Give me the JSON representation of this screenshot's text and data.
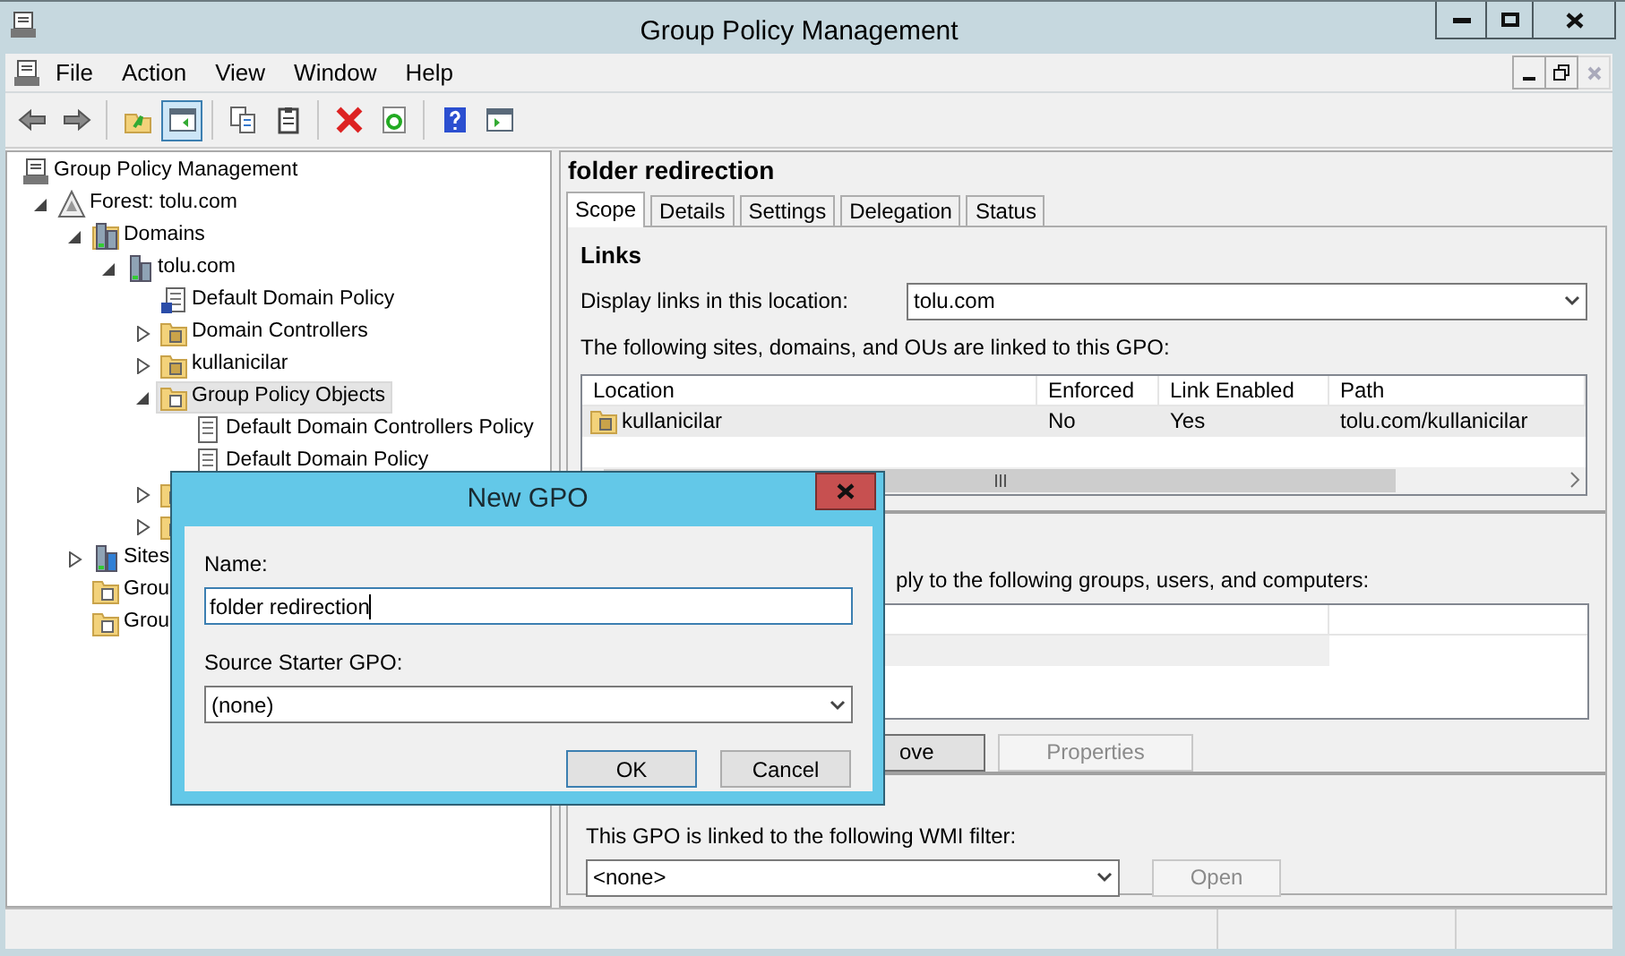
{
  "window": {
    "title": "Group Policy Management"
  },
  "menu": [
    "File",
    "Action",
    "View",
    "Window",
    "Help"
  ],
  "toolbar": [
    [
      {
        "kind": "back",
        "selected": false
      },
      {
        "kind": "forward",
        "selected": false
      }
    ],
    [
      {
        "kind": "up",
        "selected": false
      },
      {
        "kind": "tree",
        "selected": true
      }
    ],
    [
      {
        "kind": "copy",
        "selected": false
      },
      {
        "kind": "paste",
        "selected": false
      }
    ],
    [
      {
        "kind": "delete",
        "selected": false
      },
      {
        "kind": "refresh",
        "selected": false
      }
    ],
    [
      {
        "kind": "help",
        "selected": false
      },
      {
        "kind": "pane",
        "selected": false
      }
    ]
  ],
  "tree": [
    {
      "kind": "console",
      "label": "Group Policy Management",
      "selected": false,
      "children": [
        {
          "kind": "forest",
          "label": "Forest: tolu.com",
          "expanded": true,
          "selected": false,
          "children": [
            {
              "kind": "domains",
              "label": "Domains",
              "expanded": true,
              "selected": false,
              "children": [
                {
                  "kind": "domain",
                  "label": "tolu.com",
                  "expanded": true,
                  "selected": false,
                  "children": [
                    {
                      "kind": "gpo-link",
                      "label": "Default Domain Policy",
                      "selected": false
                    },
                    {
                      "kind": "ou",
                      "label": "Domain Controllers",
                      "expanded": false,
                      "selected": false
                    },
                    {
                      "kind": "ou",
                      "label": "kullanicilar",
                      "expanded": false,
                      "selected": false
                    },
                    {
                      "kind": "gpo-folder",
                      "label": "Group Policy Objects",
                      "expanded": true,
                      "selected": true,
                      "children": [
                        {
                          "kind": "gpo",
                          "label": "Default Domain Controllers Policy",
                          "selected": false
                        },
                        {
                          "kind": "gpo",
                          "label": "Default Domain Policy",
                          "selected": false
                        }
                      ]
                    },
                    {
                      "kind": "gpo-folder",
                      "expanded": false,
                      "selected": false
                    },
                    {
                      "kind": "gpo-folder",
                      "expanded": false,
                      "selected": false
                    }
                  ]
                }
              ]
            },
            {
              "kind": "sites",
              "label": "Sites",
              "expanded": false,
              "selected": false
            },
            {
              "kind": "modeling",
              "label": "Grou",
              "selected": false
            },
            {
              "kind": "results",
              "label": "Grou",
              "selected": false
            }
          ]
        }
      ]
    }
  ],
  "detail": {
    "title": "folder redirection",
    "tabs": [
      {
        "label": "Scope",
        "selected": true
      },
      {
        "label": "Details",
        "selected": false
      },
      {
        "label": "Settings",
        "selected": false
      },
      {
        "label": "Delegation",
        "selected": false
      },
      {
        "label": "Status",
        "selected": false
      }
    ],
    "links": {
      "heading": "Links",
      "location_label": "Display links in this location:",
      "location_value": "tolu.com",
      "caption": "The following sites, domains, and OUs are linked to this GPO:",
      "columns": [
        "Location",
        "Enforced",
        "Link Enabled",
        "Path"
      ],
      "rows": [
        {
          "cells": [
            "kullanicilar",
            "No",
            "Yes",
            "tolu.com/kullanicilar"
          ],
          "selected": true
        }
      ]
    },
    "security": {
      "caption": "ply to the following groups, users, and computers:",
      "rows": [
        {
          "selected": true
        }
      ],
      "buttons": [
        {
          "label": "ove",
          "disabled": false
        },
        {
          "label": "Properties",
          "disabled": true
        }
      ]
    },
    "wmi": {
      "caption": "This GPO is linked to the following WMI filter:",
      "value": "<none>",
      "button": {
        "label": "Open",
        "disabled": true
      }
    }
  },
  "dialog": {
    "title": "New GPO",
    "name_label": "Name:",
    "name_value": "folder redirection",
    "starter_label": "Source Starter GPO:",
    "starter_value": "(none)",
    "buttons": [
      {
        "label": "OK",
        "default": true
      },
      {
        "label": "Cancel",
        "default": false
      }
    ]
  }
}
